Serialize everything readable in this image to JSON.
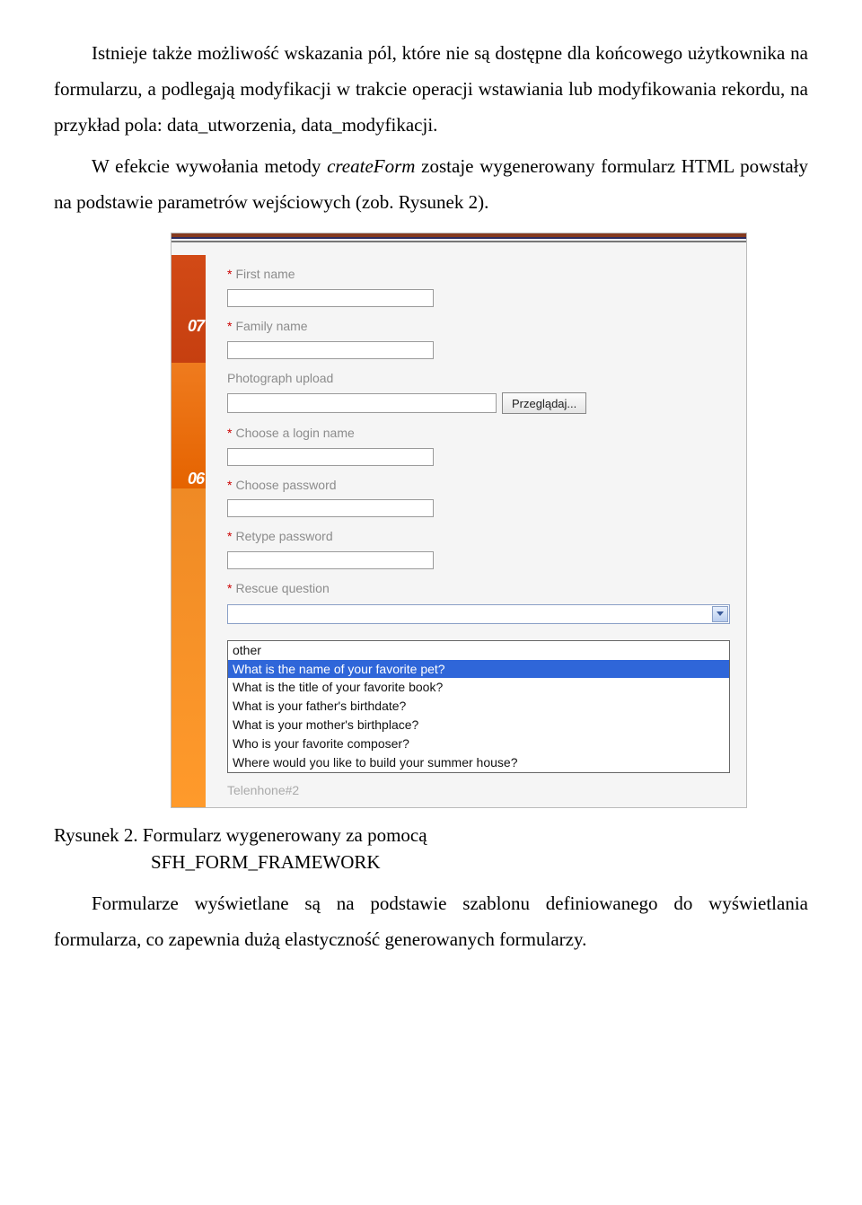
{
  "paragraphs": {
    "p1": "Istnieje także możliwość wskazania pól, które nie są dostępne dla końcowego użytkownika na formularzu, a podlegają modyfikacji w trakcie operacji wstawiania lub modyfikowania rekordu, na przykład pola: data_utworzenia, data_modyfikacji.",
    "p2a": "W efekcie wywołania metody ",
    "p2_itm": "createForm",
    "p2b": " zostaje wygenerowany formularz HTML powstały na podstawie parametrów wejściowych (zob. Rysunek 2)."
  },
  "sidebar": {
    "year1": "07",
    "year2": "06"
  },
  "form": {
    "first_name": "First name",
    "family_name": "Family name",
    "photo": "Photograph upload",
    "browse_btn": "Przeglądaj...",
    "login": "Choose a login name",
    "password": "Choose password",
    "retype": "Retype password",
    "rescue": "Rescue question",
    "asterisk": "*"
  },
  "dropdown": {
    "options": [
      "other",
      "What is the name of your favorite pet?",
      "What is the title of your favorite book?",
      "What is your father's birthdate?",
      "What is your mother's birthplace?",
      "Who is your favorite composer?",
      "Where would you like to build your summer house?"
    ],
    "selected_index": 1
  },
  "truncated_label": "Telenhone#2",
  "caption": {
    "line1": "Rysunek 2. Formularz wygenerowany za pomocą",
    "line2": "SFH_FORM_FRAMEWORK"
  },
  "paragraphs2": {
    "p3": "Formularze wyświetlane są na podstawie szablonu definiowanego do wyświetlania formularza, co zapewnia dużą elastyczność generowanych formularzy."
  }
}
